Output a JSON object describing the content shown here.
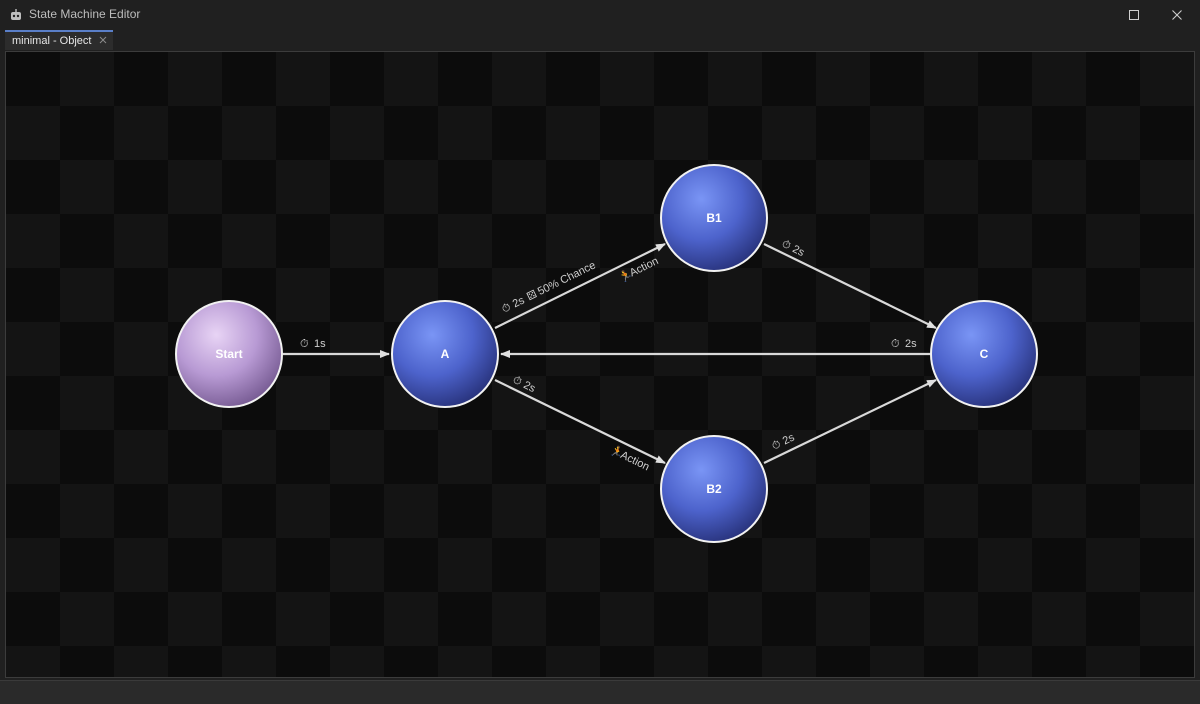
{
  "window": {
    "title": "State Machine Editor",
    "icon": "robot-icon"
  },
  "tabs": [
    {
      "label": "minimal - Object",
      "active": true
    }
  ],
  "graph": {
    "colors": {
      "start_node": "#c8a8e0",
      "state_node": "#5a72d8",
      "edge": "#d9d9d9",
      "background": "#0c0c0c"
    },
    "nodes": {
      "start": "Start",
      "a": "A",
      "b1": "B1",
      "b2": "B2",
      "c": "C"
    },
    "edges": {
      "start_a": {
        "timer": "1s"
      },
      "a_b1": {
        "timer": "2s",
        "chance": "50% Chance",
        "action": "Action"
      },
      "a_b2": {
        "timer": "2s",
        "action": "Action"
      },
      "b1_c": {
        "timer": "2s"
      },
      "b2_c": {
        "timer": "2s"
      },
      "c_a": {
        "timer": "2s"
      }
    }
  }
}
